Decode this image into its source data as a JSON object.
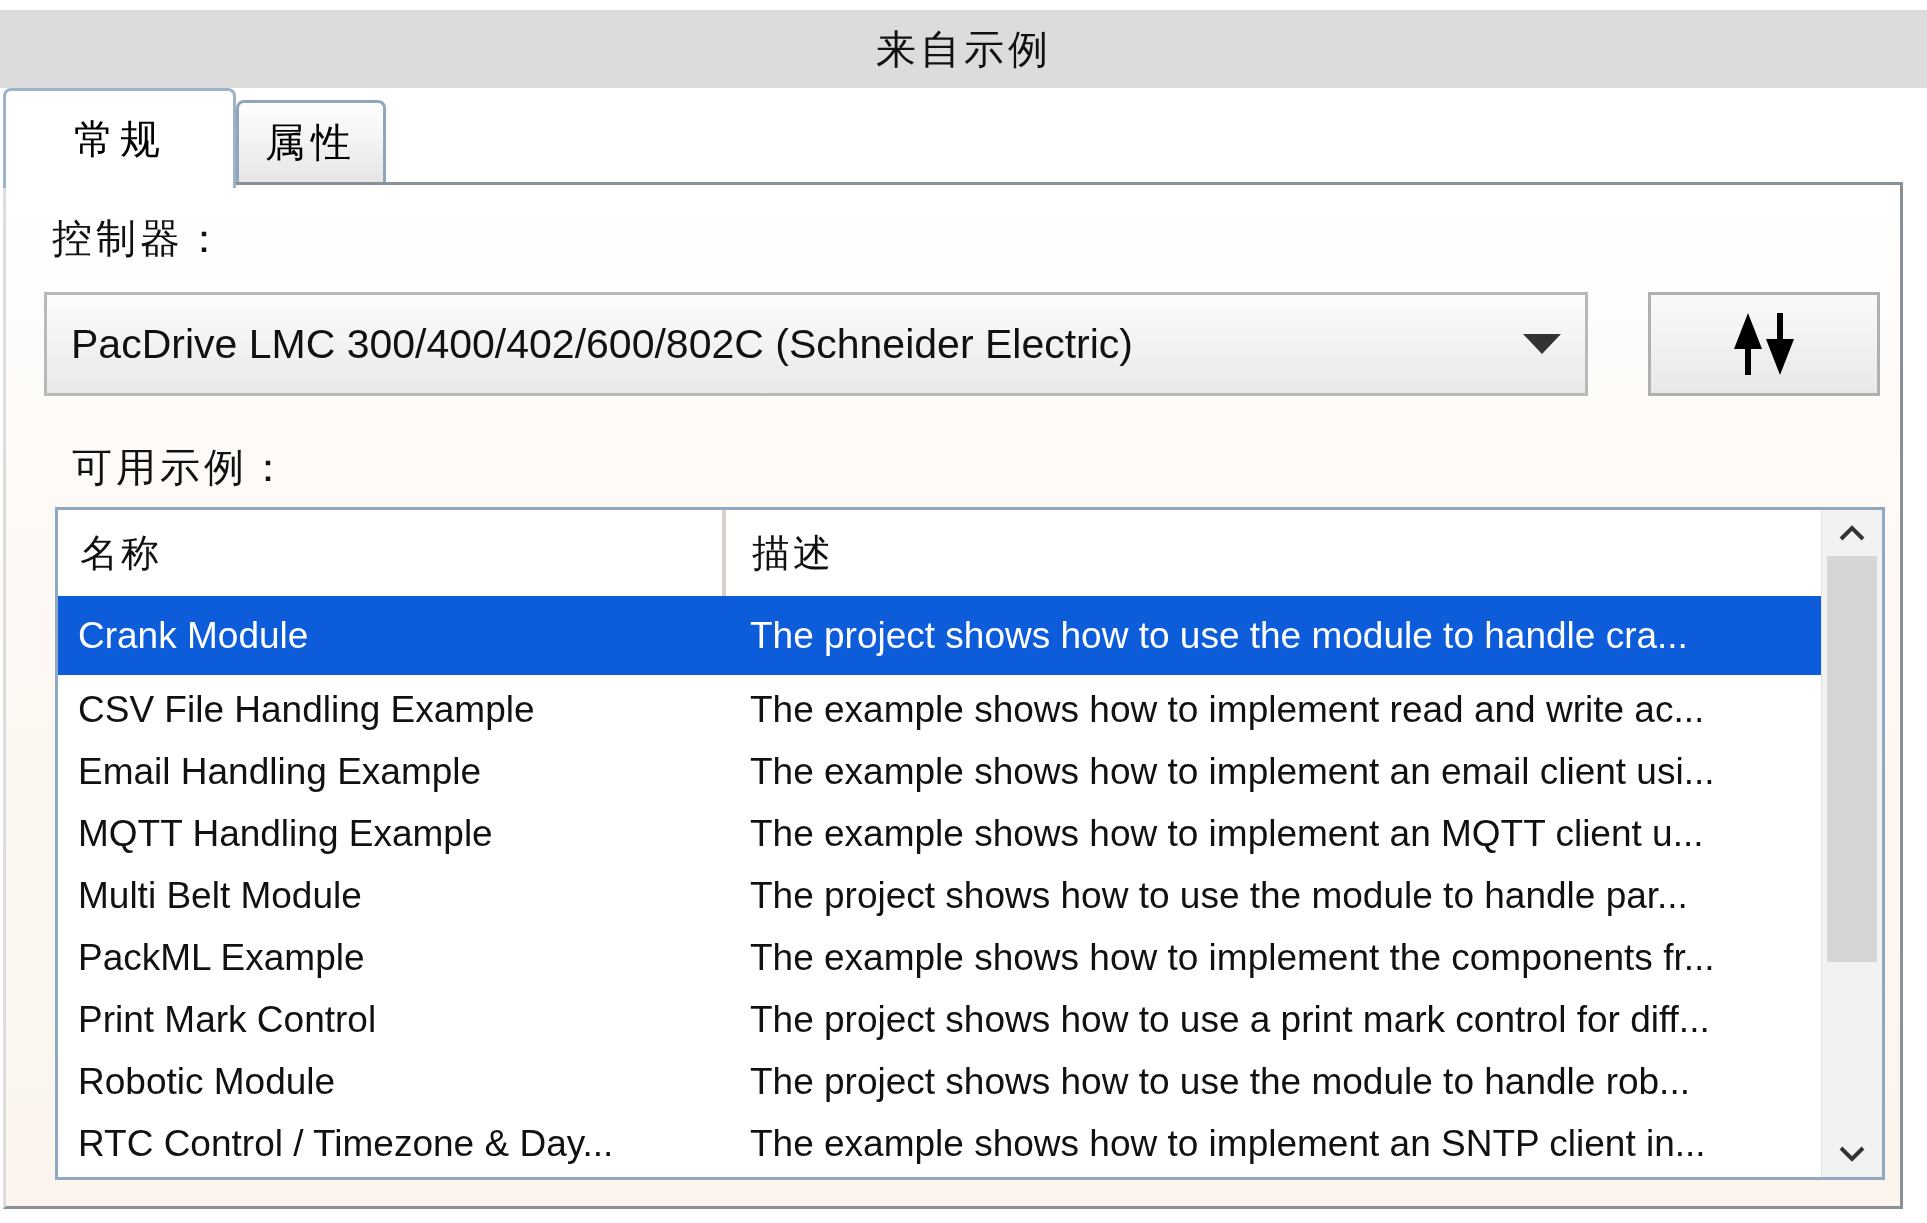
{
  "window": {
    "title": "来自示例"
  },
  "tabs": [
    {
      "label": "常规",
      "selected": true
    },
    {
      "label": "属性",
      "selected": false
    }
  ],
  "controller": {
    "label": "控制器：",
    "value": "PacDrive LMC 300/400/402/600/802C (Schneider Electric)"
  },
  "examples": {
    "label": "可用示例：",
    "columns": [
      "名称",
      "描述"
    ],
    "rows": [
      {
        "name": "Crank Module",
        "description": "The project shows how to use the module to handle cra...",
        "selected": true
      },
      {
        "name": "CSV File Handling Example",
        "description": "The example shows how to implement read and write ac...",
        "selected": false
      },
      {
        "name": "Email Handling Example",
        "description": "The example shows how to implement an email client usi...",
        "selected": false
      },
      {
        "name": "MQTT Handling Example",
        "description": "The example shows how to implement an MQTT client u...",
        "selected": false
      },
      {
        "name": "Multi Belt Module",
        "description": "The project shows how to use the module to handle par...",
        "selected": false
      },
      {
        "name": "PackML Example",
        "description": "The example shows how to implement the components fr...",
        "selected": false
      },
      {
        "name": "Print Mark Control",
        "description": "The project shows how to use a print mark control for diff...",
        "selected": false
      },
      {
        "name": "Robotic Module",
        "description": "The project shows how to use the module to handle rob...",
        "selected": false
      },
      {
        "name": "RTC Control / Timezone & Day...",
        "description": "The example shows how to implement an SNTP client in...",
        "selected": false
      }
    ]
  }
}
